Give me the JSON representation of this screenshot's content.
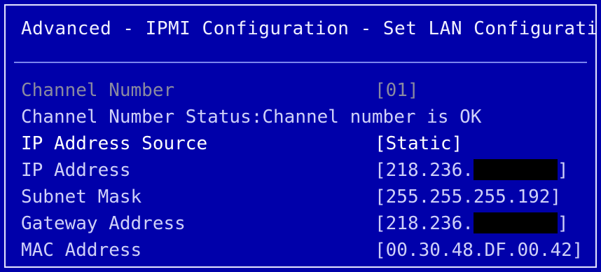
{
  "title": "Advanced - IPMI Configuration - Set LAN Configurati",
  "rows": [
    {
      "label": "Channel Number",
      "value": "[01]"
    },
    {
      "label": "Channel Number Status:Channel number is OK",
      "value": ""
    },
    {
      "label": "IP Address Source",
      "value": "[Static]"
    },
    {
      "label": "IP Address",
      "value_prefix": "[218.236.",
      "value_suffix": "]"
    },
    {
      "label": "Subnet Mask",
      "value": "[255.255.255.192]"
    },
    {
      "label": "Gateway Address",
      "value_prefix": "[218.236.",
      "value_suffix": "]"
    },
    {
      "label": "MAC Address",
      "value": "[00.30.48.DF.00.42]"
    }
  ],
  "colors": {
    "background": "#0000aa",
    "disabled_text": "#8a8aa0",
    "normal_text": "#cfd0f8",
    "highlight_text": "#ffffff",
    "redaction": "#000000"
  }
}
